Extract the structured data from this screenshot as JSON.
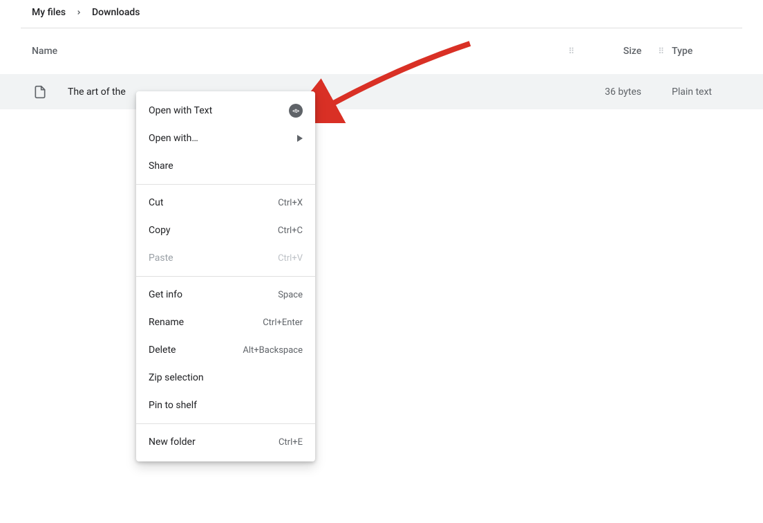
{
  "breadcrumb": {
    "root": "My files",
    "current": "Downloads"
  },
  "columns": {
    "name": "Name",
    "size": "Size",
    "type": "Type"
  },
  "file": {
    "name": "The art of the",
    "size": "36 bytes",
    "type": "Plain text"
  },
  "context_menu": {
    "open_with_text": "Open with Text",
    "open_with": "Open with…",
    "share": "Share",
    "cut": {
      "label": "Cut",
      "shortcut": "Ctrl+X"
    },
    "copy": {
      "label": "Copy",
      "shortcut": "Ctrl+C"
    },
    "paste": {
      "label": "Paste",
      "shortcut": "Ctrl+V"
    },
    "get_info": {
      "label": "Get info",
      "shortcut": "Space"
    },
    "rename": {
      "label": "Rename",
      "shortcut": "Ctrl+Enter"
    },
    "delete": {
      "label": "Delete",
      "shortcut": "Alt+Backspace"
    },
    "zip": "Zip selection",
    "pin": "Pin to shelf",
    "new_folder": {
      "label": "New folder",
      "shortcut": "Ctrl+E"
    }
  }
}
